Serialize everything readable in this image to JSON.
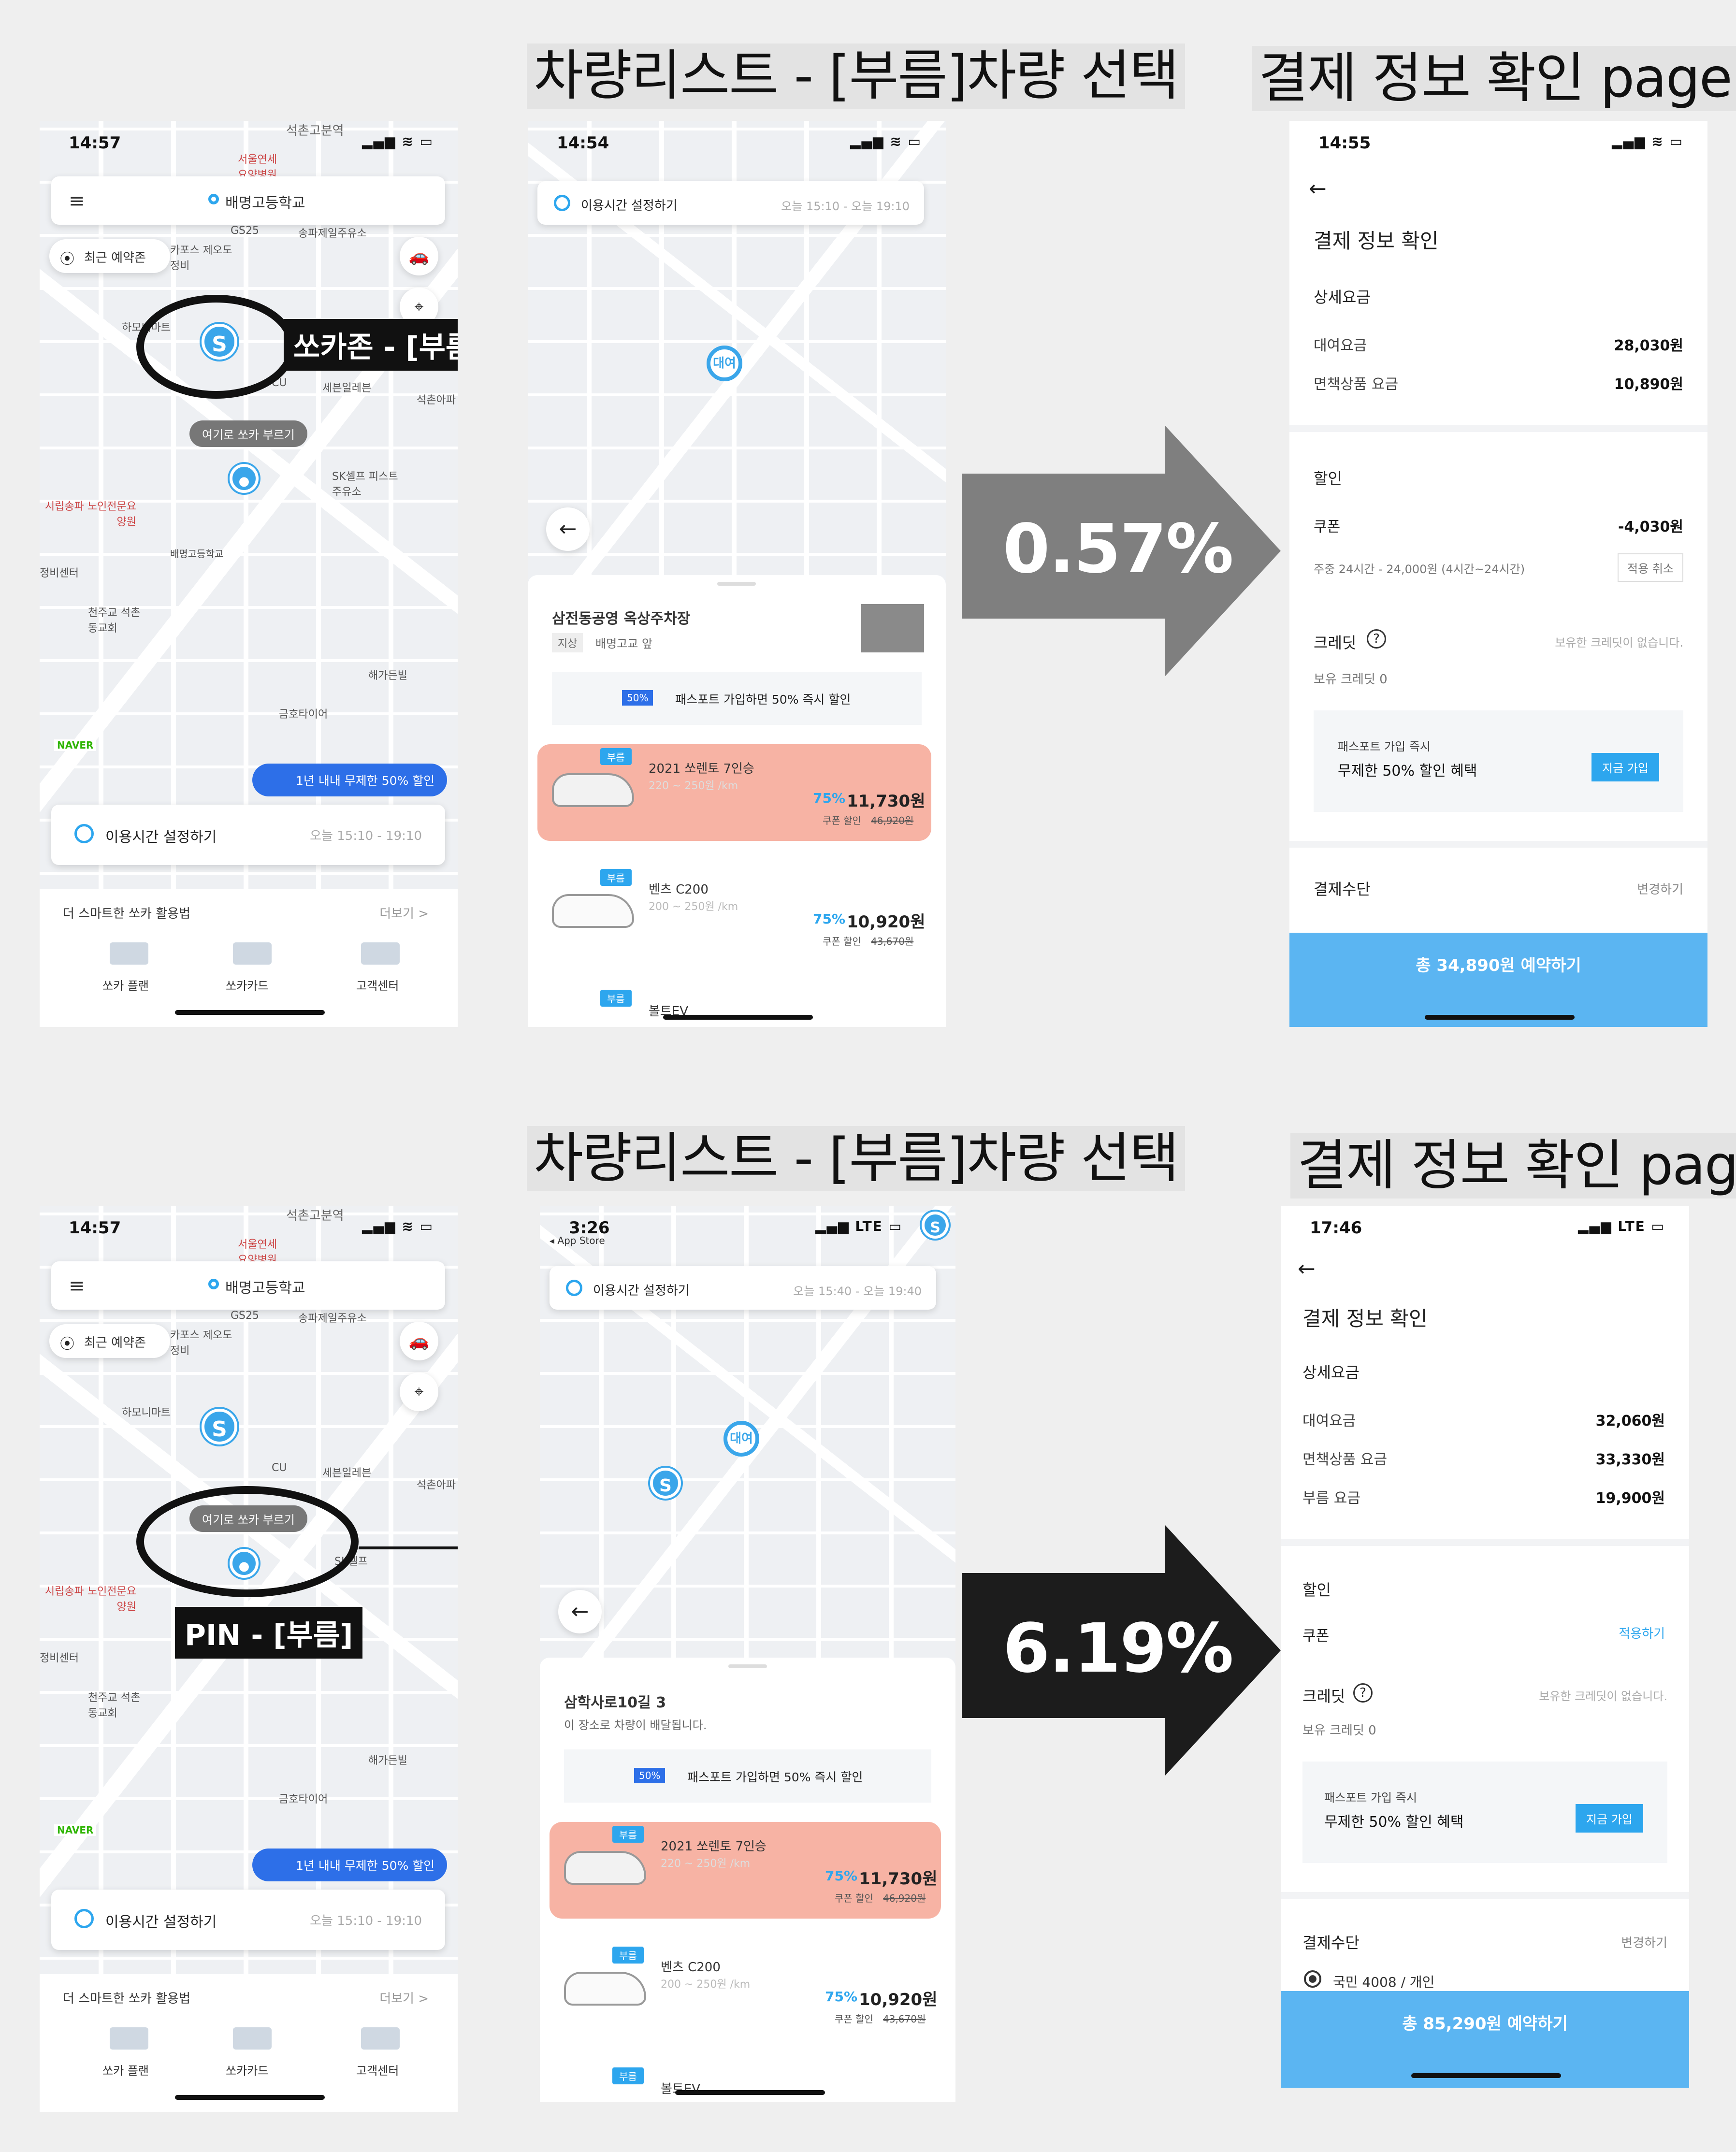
{
  "headings": {
    "top_list": "차량리스트 - [부름]차량 선택",
    "top_pay": "결제 정보 확인 page",
    "bottom_list": "차량리스트 - [부름]차량 선택",
    "bottom_pay": "결제 정보 확인 page"
  },
  "arrows": {
    "top_rate": "0.57%",
    "bottom_rate": "6.19%"
  },
  "home_top": {
    "time": "14:57",
    "search": "배명고등학교",
    "recent": "최근 예약존",
    "call_here": "여기로 쏘카 부르기",
    "callout": "쏘카존 - [부름]",
    "promo": "1년 내내 무제한 50% 할인",
    "usage_label": "이용시간 설정하기",
    "usage_time": "오늘 15:10 - 19:10",
    "smart": "더 스마트한 쏘카 활용법",
    "more": "더보기 >",
    "menu": [
      "쏘카 플랜",
      "쏘카카드",
      "고객센터"
    ],
    "map_labels": [
      "석촌고분역",
      "서울연세요양병원",
      "카포스 제오도정비",
      "GS25",
      "송파제일주유소",
      "세븐일레븐",
      "석촌아파",
      "SK셀프 피스트주유소",
      "배명고등학교",
      "시립송파 노인전문요양원",
      "천주교 석촌동교회",
      "해가든빌",
      "금호타이어",
      "정비센터",
      "하모니마트",
      "CU",
      "NAVER"
    ]
  },
  "home_bottom": {
    "time": "14:57",
    "search": "배명고등학교",
    "recent": "최근 예약존",
    "call_here": "여기로 쏘카 부르기",
    "callout": "PIN - [부름]",
    "promo": "1년 내내 무제한 50% 할인",
    "usage_label": "이용시간 설정하기",
    "usage_time": "오늘 15:10 - 19:10",
    "smart": "더 스마트한 쏘카 활용법",
    "more": "더보기 >",
    "menu": [
      "쏘카 플랜",
      "쏘카카드",
      "고객센터"
    ],
    "map_labels": [
      "석촌고분역",
      "서울연세요양병원",
      "카포스 제오도정비",
      "GS25",
      "송파제일주유소",
      "세븐일레븐",
      "석촌아파",
      "SK셀프",
      "시립송파 노인전문요양원",
      "천주교 석촌동교회",
      "해가든빌",
      "금호타이어",
      "정비센터",
      "하모니마트",
      "CU",
      "NAVER"
    ]
  },
  "list_top": {
    "time": "14:54",
    "usage_label": "이용시간 설정하기",
    "usage_time": "오늘 15:10 - 오늘 19:10",
    "pin_label": "대여",
    "place": "삼전동공영 옥상주차장",
    "place_sub_tag": "지상",
    "place_sub": "배명고교 앞",
    "pass": "패스포트 가입하면 50% 즉시 할인",
    "cars": [
      {
        "tag": "부름",
        "name": "2021 쏘렌토 7인승",
        "dist": "220 ~ 250원 /km",
        "pct": "75%",
        "price": "11,730원",
        "coupon": "쿠폰 할인",
        "orig": "46,920원"
      },
      {
        "tag": "부름",
        "name": "벤츠 C200",
        "dist": "200 ~ 250원 /km",
        "pct": "75%",
        "price": "10,920원",
        "coupon": "쿠폰 할인",
        "orig": "43,670원"
      },
      {
        "tag": "부름",
        "name": "볼트EV"
      }
    ]
  },
  "list_bottom": {
    "time": "3:26",
    "back_app": "◂ App Store",
    "network": "LTE",
    "usage_label": "이용시간 설정하기",
    "usage_time": "오늘 15:40 - 오늘 19:40",
    "pin_label": "대여",
    "place": "삼학사로10길 3",
    "place_sub": "이 장소로 차량이 배달됩니다.",
    "pass": "패스포트 가입하면 50% 즉시 할인",
    "cars": [
      {
        "tag": "부름",
        "name": "2021 쏘렌토 7인승",
        "dist": "220 ~ 250원 /km",
        "pct": "75%",
        "price": "11,730원",
        "coupon": "쿠폰 할인",
        "orig": "46,920원"
      },
      {
        "tag": "부름",
        "name": "벤츠 C200",
        "dist": "200 ~ 250원 /km",
        "pct": "75%",
        "price": "10,920원",
        "coupon": "쿠폰 할인",
        "orig": "43,670원"
      },
      {
        "tag": "부름",
        "name": "볼트EV"
      }
    ]
  },
  "pay_top": {
    "time": "14:55",
    "title": "결제 정보 확인",
    "detail": "상세요금",
    "rows": [
      {
        "label": "대여요금",
        "value": "28,030원"
      },
      {
        "label": "면책상품 요금",
        "value": "10,890원"
      }
    ],
    "discount": "할인",
    "coupon": "쿠폰",
    "coupon_value": "-4,030원",
    "coupon_desc": "주중 24시간 - 24,000원 (4시간~24시간)",
    "coupon_cancel": "적용 취소",
    "credit": "크레딧",
    "credit_none": "보유한 크레딧이 없습니다.",
    "credit_have": "보유 크레딧 0",
    "pass_title": "패스포트 가입 즉시",
    "pass_desc": "무제한 50% 할인 혜택",
    "pass_btn": "지금 가입",
    "method": "결제수단",
    "method_change": "변경하기",
    "cta": "총 34,890원 예약하기"
  },
  "pay_bottom": {
    "time": "17:46",
    "network": "LTE",
    "title": "결제 정보 확인",
    "detail": "상세요금",
    "rows": [
      {
        "label": "대여요금",
        "value": "32,060원"
      },
      {
        "label": "면책상품 요금",
        "value": "33,330원"
      },
      {
        "label": "부름 요금",
        "value": "19,900원"
      }
    ],
    "discount": "할인",
    "coupon": "쿠폰",
    "coupon_apply": "적용하기",
    "credit": "크레딧",
    "credit_none": "보유한 크레딧이 없습니다.",
    "credit_have": "보유 크레딧 0",
    "pass_title": "패스포트 가입 즉시",
    "pass_desc": "무제한 50% 할인 혜택",
    "pass_btn": "지금 가입",
    "method": "결제수단",
    "method_change": "변경하기",
    "card": "국민 4008 / 개인",
    "cta": "총 85,290원 예약하기"
  },
  "colors": {
    "accent": "#2da6ee",
    "highlight_row": "#f7b3a4",
    "cta": "#5bb5f2",
    "arrow_top": "#7f7f7f",
    "arrow_bottom": "#1c1c1c"
  }
}
